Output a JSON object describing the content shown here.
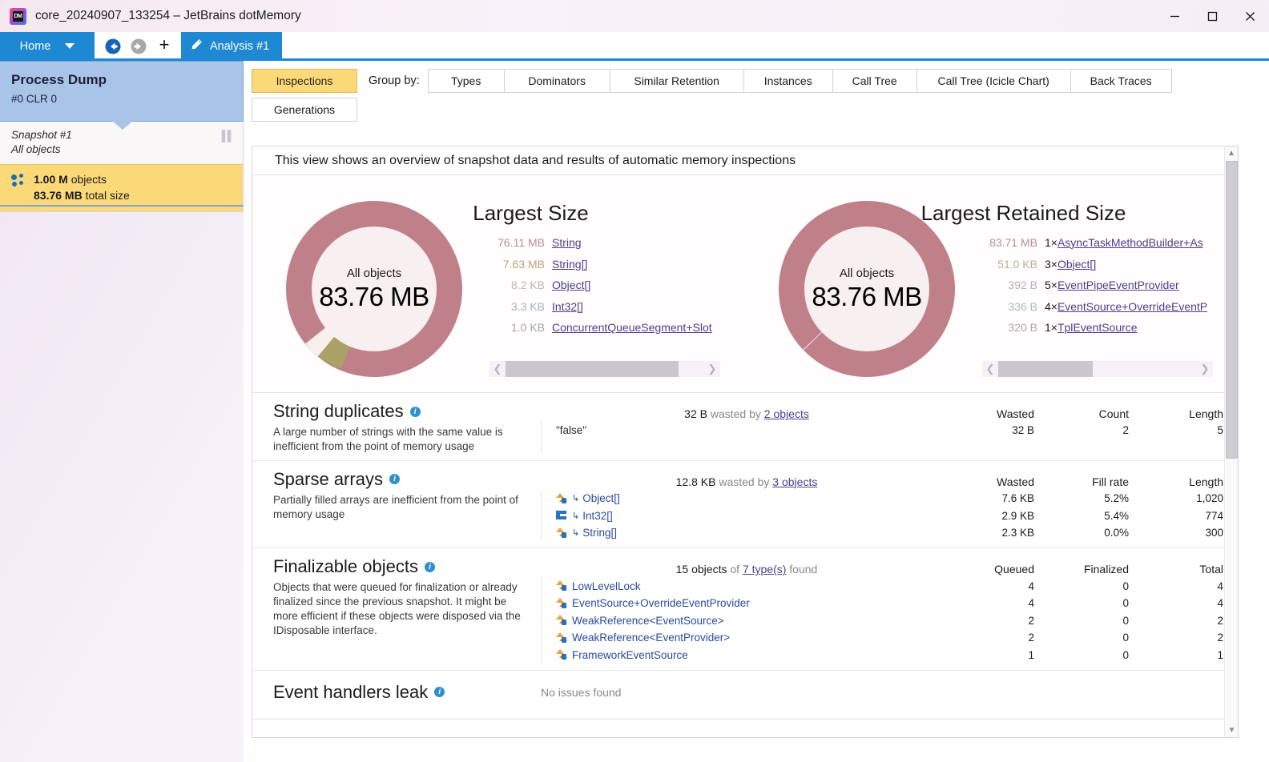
{
  "window": {
    "title": "core_20240907_133254 – JetBrains dotMemory",
    "app_icon": "dm",
    "minimize": "minimize-icon",
    "maximize": "maximize-icon",
    "close": "close-icon"
  },
  "tabstrip": {
    "home_label": "Home",
    "back_icon": "back-arrow-icon",
    "forward_icon": "forward-arrow-icon",
    "add_icon": "plus-icon",
    "analysis_tab_label": "Analysis #1",
    "analysis_tab_icon": "pencil-icon",
    "accent_color": "#1e88d2"
  },
  "sidebar": {
    "process_dump_title": "Process Dump",
    "process_dump_sub": "#0 CLR 0",
    "snapshot_title": "Snapshot #1",
    "snapshot_sub": "All objects",
    "objects_count": "1.00 M",
    "objects_count_suffix": "objects",
    "total_size": "83.76 MB",
    "total_size_suffix": "total size",
    "highlight_color": "#fcd978",
    "selected_color": "#a8c5e8"
  },
  "toolbar": {
    "inspections_label": "Inspections",
    "generations_label": "Generations",
    "group_by_label": "Group by:",
    "group_buttons": [
      "Types",
      "Dominators",
      "Similar Retention",
      "Instances",
      "Call Tree",
      "Call Tree (Icicle Chart)",
      "Back Traces"
    ]
  },
  "banner": "This view shows an overview of snapshot data and results of automatic memory inspections",
  "chart_data": [
    {
      "type": "pie",
      "title": "Largest Size",
      "center_label": "All objects",
      "center_value": "83.76 MB",
      "categories": [
        "String",
        "String[]",
        "Object[]",
        "Int32[]",
        "ConcurrentQueueSegment+Slot"
      ],
      "values": [
        76.11,
        7.63,
        0.0082,
        0.0033,
        0.001
      ],
      "value_labels": [
        "76.11 MB",
        "7.63 MB",
        "8.2 KB",
        "3.3 KB",
        "1.0 KB"
      ],
      "colors": [
        "#c08089",
        "#aba066",
        "#f3ece4",
        "#e9e0d8",
        "#ded4ca"
      ],
      "legend": "right",
      "scroll_position": 0.0
    },
    {
      "type": "pie",
      "title": "Largest Retained Size",
      "center_label": "All objects",
      "center_value": "83.76 MB",
      "categories": [
        "AsyncTaskMethodBuilder+As",
        "Object[]",
        "EventPipeEventProvider",
        "EventSource+OverrideEventP",
        "TplEventSource"
      ],
      "values": [
        83.71,
        0.051,
        0.000392,
        0.000336,
        0.00032
      ],
      "value_labels": [
        "83.71 MB",
        "51.0 KB",
        "392 B",
        "336 B",
        "320 B"
      ],
      "multipliers": [
        "1×",
        "3×",
        "5×",
        "4×",
        "1×"
      ],
      "colors": [
        "#c08089",
        "#c08089",
        "#c08089",
        "#c08089",
        "#c08089"
      ],
      "legend": "right",
      "scroll_position": 0.0
    }
  ],
  "largest_size": {
    "title": "Largest Size",
    "center_label": "All objects",
    "center_value": "83.76 MB",
    "rows": [
      {
        "size": "76.11 MB",
        "mult": "",
        "name": "String"
      },
      {
        "size": "7.63 MB",
        "mult": "",
        "name": "String[]"
      },
      {
        "size": "8.2 KB",
        "mult": "",
        "name": "Object[]"
      },
      {
        "size": "3.3 KB",
        "mult": "",
        "name": "Int32[]"
      },
      {
        "size": "1.0 KB",
        "mult": "",
        "name": "ConcurrentQueueSegment+Slot"
      }
    ]
  },
  "largest_retained": {
    "title": "Largest Retained Size",
    "center_label": "All objects",
    "center_value": "83.76 MB",
    "rows": [
      {
        "size": "83.71 MB",
        "mult": "1×",
        "name": "AsyncTaskMethodBuilder+As"
      },
      {
        "size": "51.0 KB",
        "mult": "3×",
        "name": "Object[]"
      },
      {
        "size": "392 B",
        "mult": "5×",
        "name": "EventPipeEventProvider"
      },
      {
        "size": "336 B",
        "mult": "4×",
        "name": "EventSource+OverrideEventP"
      },
      {
        "size": "320 B",
        "mult": "1×",
        "name": "TplEventSource"
      }
    ]
  },
  "sections": {
    "string_duplicates": {
      "title": "String duplicates",
      "info_icon": "info-icon",
      "summary_prefix": "32 B",
      "summary_mid": " wasted by ",
      "summary_link": "2 objects",
      "description": "A large number of strings with the same value is inefficient from the point of memory usage",
      "columns": [
        "Wasted",
        "Count",
        "Length"
      ],
      "rows": [
        {
          "name": "\"false\"",
          "c1": "32 B",
          "c2": "2",
          "c3": "5"
        }
      ]
    },
    "sparse_arrays": {
      "title": "Sparse arrays",
      "info_icon": "info-icon",
      "summary_prefix": "12.8 KB",
      "summary_mid": " wasted by ",
      "summary_link": "3 objects",
      "description": "Partially filled arrays are inefficient from the point of memory usage",
      "columns": [
        "Wasted",
        "Fill rate",
        "Length"
      ],
      "rows": [
        {
          "icon": "object-array-icon",
          "name": "Object[]",
          "c1": "7.6 KB",
          "c2": "5.2%",
          "c3": "1,020"
        },
        {
          "icon": "int32-array-icon",
          "name": "Int32[]",
          "c1": "2.9 KB",
          "c2": "5.4%",
          "c3": "774"
        },
        {
          "icon": "string-array-icon",
          "name": "String[]",
          "c1": "2.3 KB",
          "c2": "0.0%",
          "c3": "300"
        }
      ]
    },
    "finalizable_objects": {
      "title": "Finalizable objects",
      "info_icon": "info-icon",
      "summary_prefix": "15 objects",
      "summary_mid": " of ",
      "summary_link": "7 type(s)",
      "summary_suffix": " found",
      "description": "Objects that were queued for finalization or already finalized since the previous snapshot. It might be more efficient if these objects were disposed via the IDisposable interface.",
      "columns": [
        "Queued",
        "Finalized",
        "Total"
      ],
      "rows": [
        {
          "icon": "class-icon",
          "name": "LowLevelLock",
          "c1": "4",
          "c2": "0",
          "c3": "4"
        },
        {
          "icon": "class-icon",
          "name": "EventSource+OverrideEventProvider",
          "c1": "4",
          "c2": "0",
          "c3": "4"
        },
        {
          "icon": "class-icon",
          "name": "WeakReference<EventSource>",
          "c1": "2",
          "c2": "0",
          "c3": "2"
        },
        {
          "icon": "class-icon",
          "name": "WeakReference<EventProvider>",
          "c1": "2",
          "c2": "0",
          "c3": "2"
        },
        {
          "icon": "class-icon",
          "name": "FrameworkEventSource",
          "c1": "1",
          "c2": "0",
          "c3": "1"
        }
      ]
    },
    "event_handlers_leak": {
      "title": "Event handlers leak",
      "info_icon": "info-icon",
      "summary": "No issues found"
    }
  },
  "scrollbars": {
    "vertical_up_icon": "chevron-up-icon",
    "vertical_down_icon": "chevron-down-icon",
    "h_left_icon": "chevron-left-icon",
    "h_right_icon": "chevron-right-icon"
  }
}
